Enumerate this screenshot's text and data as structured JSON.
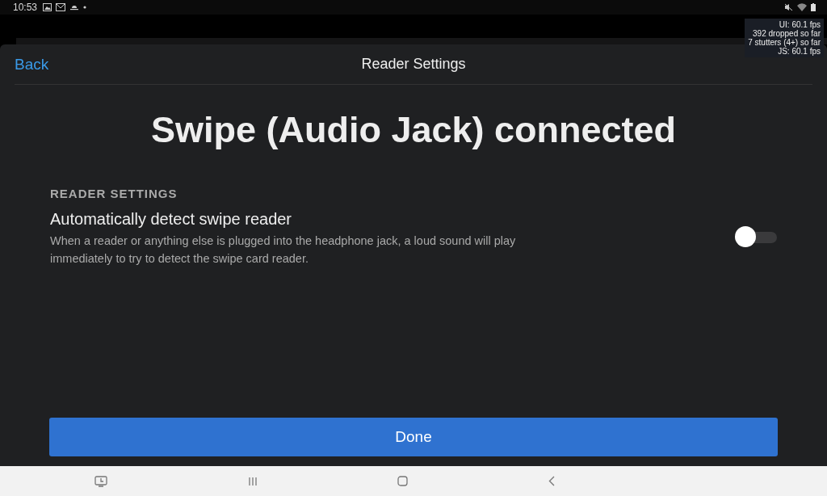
{
  "status_bar": {
    "time": "10:53"
  },
  "perf_overlay": {
    "lines": [
      "UI: 60.1 fps",
      "392 dropped so far",
      "7 stutters (4+) so far",
      "JS: 60.1 fps"
    ]
  },
  "header": {
    "back": "Back",
    "title": "Reader Settings"
  },
  "heading": "Swipe (Audio Jack) connected",
  "section": {
    "title": "READER SETTINGS",
    "setting": {
      "label": "Automatically detect swipe reader",
      "description": "When a reader or anything else is plugged into the headphone jack, a loud sound will play immediately to try to detect the swipe card reader.",
      "on": false
    }
  },
  "done_button": "Done"
}
